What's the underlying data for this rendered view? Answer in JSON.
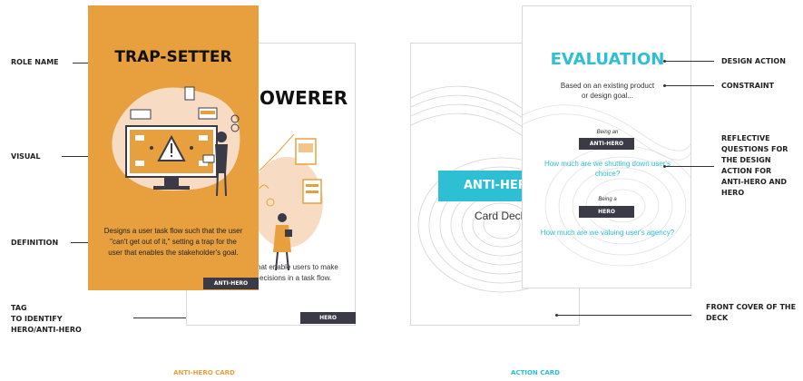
{
  "annotations_left": {
    "role_name": "ROLE NAME",
    "visual": "VISUAL",
    "definition": "DEFINITION",
    "tag_line1": "TAG",
    "tag_line2": "TO IDENTIFY",
    "tag_line3": "HERO/ANTI-HERO"
  },
  "annotations_right": {
    "design_action": "DESIGN ACTION",
    "constraint": "CONSTRAINT",
    "reflective_line1": "REFLECTIVE",
    "reflective_line2": "QUESTIONS FOR",
    "reflective_line3": "THE DESIGN",
    "reflective_line4": "ACTION FOR",
    "reflective_line5": "ANTI-HERO AND",
    "reflective_line6": "HERO",
    "front_cover_line1": "FRONT COVER OF THE",
    "front_cover_line2": "DECK"
  },
  "trap_card": {
    "title": "TRAP-SETTER",
    "definition_line1": "Designs a user task flow such that the user",
    "definition_line2": "\"can't get out of it,\" setting a trap for the",
    "definition_line3": "user that enables the stakeholder's goal.",
    "tag": "ANTI-HERO"
  },
  "empowerer_card": {
    "title": "OWERER",
    "definition_line1": "hat enable users to make",
    "definition_line2": "ecisions in a task flow.",
    "tag": "HERO"
  },
  "deck_cover": {
    "banner": "ANTI-HERO",
    "subtitle": "Card Deck"
  },
  "evaluation_card": {
    "title": "EVALUATION",
    "constraint_line1": "Based on an existing product",
    "constraint_line2": "or design goal...",
    "being_an": "Being an",
    "anti_hero_tag": "ANTI-HERO",
    "question1_line1": "How much are we shutting down user's",
    "question1_line2": "choice?",
    "being_a": "Being a",
    "hero_tag": "HERO",
    "question2": "How much are we valuing user's agency?"
  },
  "captions": {
    "anti_hero_card": "ANTI-HERO CARD",
    "action_card": "ACTION CARD"
  },
  "colors": {
    "orange": "#E8A03E",
    "cyan": "#2DBFD3",
    "dark_tag": "#3B3B47"
  }
}
